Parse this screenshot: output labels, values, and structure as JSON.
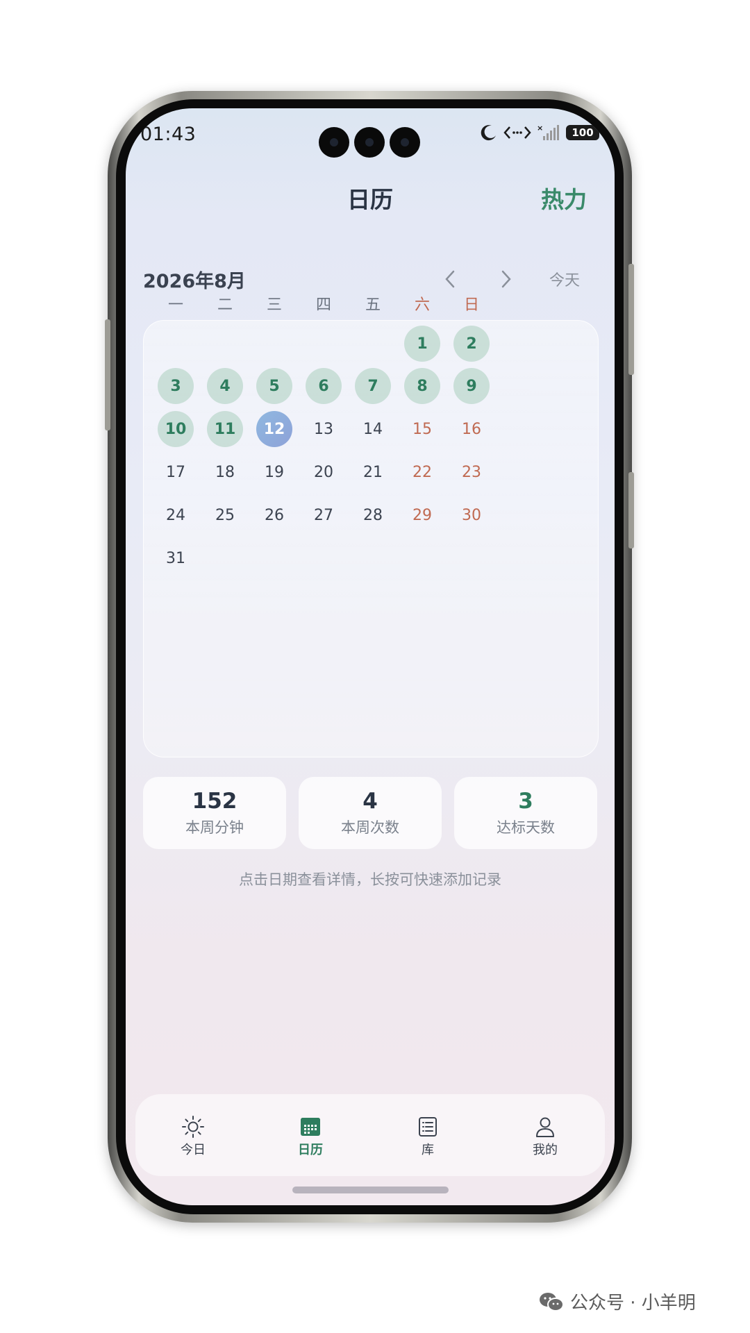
{
  "status_bar": {
    "time": "01:43",
    "battery": "100"
  },
  "header": {
    "title": "日历",
    "heat_label": "热力"
  },
  "calendar": {
    "month_label": "2026年8月",
    "today_label": "今天",
    "weekdays": [
      "一",
      "二",
      "三",
      "四",
      "五",
      "六",
      "日"
    ],
    "days": [
      {
        "label": "1",
        "state": "done"
      },
      {
        "label": "2",
        "state": "done"
      },
      {
        "label": "3",
        "state": "done"
      },
      {
        "label": "4",
        "state": "done"
      },
      {
        "label": "5",
        "state": "done"
      },
      {
        "label": "6",
        "state": "done"
      },
      {
        "label": "7",
        "state": "done"
      },
      {
        "label": "8",
        "state": "done"
      },
      {
        "label": "9",
        "state": "done"
      },
      {
        "label": "10",
        "state": "done"
      },
      {
        "label": "11",
        "state": "done"
      },
      {
        "label": "12",
        "state": "today"
      },
      {
        "label": "13",
        "state": "none"
      },
      {
        "label": "14",
        "state": "none"
      },
      {
        "label": "15",
        "state": "none"
      },
      {
        "label": "16",
        "state": "none"
      },
      {
        "label": "17",
        "state": "none"
      },
      {
        "label": "18",
        "state": "none"
      },
      {
        "label": "19",
        "state": "none"
      },
      {
        "label": "20",
        "state": "none"
      },
      {
        "label": "21",
        "state": "none"
      },
      {
        "label": "22",
        "state": "none"
      },
      {
        "label": "23",
        "state": "none"
      },
      {
        "label": "24",
        "state": "none"
      },
      {
        "label": "25",
        "state": "none"
      },
      {
        "label": "26",
        "state": "none"
      },
      {
        "label": "27",
        "state": "none"
      },
      {
        "label": "28",
        "state": "none"
      },
      {
        "label": "29",
        "state": "none"
      },
      {
        "label": "30",
        "state": "none"
      },
      {
        "label": "31",
        "state": "none"
      }
    ]
  },
  "stats": [
    {
      "value": "152",
      "label": "本周分钟"
    },
    {
      "value": "4",
      "label": "本周次数"
    },
    {
      "value": "3",
      "label": "达标天数"
    }
  ],
  "hint": "点击日期查看详情，长按可快速添加记录",
  "nav": [
    {
      "label": "今日",
      "icon": "sun-icon"
    },
    {
      "label": "日历",
      "icon": "calendar-icon",
      "active": true
    },
    {
      "label": "库",
      "icon": "list-icon"
    },
    {
      "label": "我的",
      "icon": "user-icon"
    }
  ],
  "watermark": "公众号 · 小羊明",
  "colors": {
    "accent_green": "#2e7d5e",
    "weekend": "#c06a52",
    "today_gradient_start": "#8fb8e0",
    "today_gradient_end": "#8ea2d8"
  }
}
